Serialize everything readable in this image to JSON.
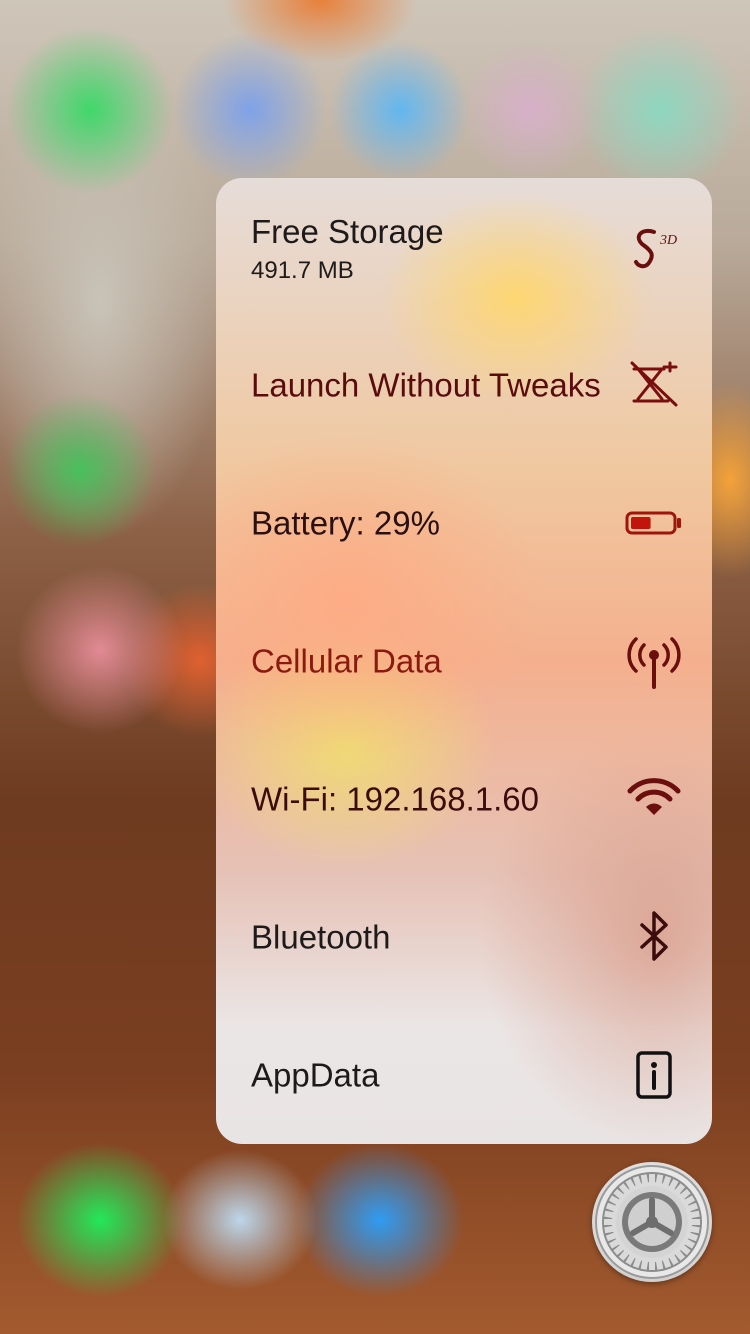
{
  "menu": {
    "items": [
      {
        "title": "Free Storage",
        "subtitle": "491.7 MB",
        "icon": "s3d-logo-icon"
      },
      {
        "title": "Launch Without Tweaks",
        "icon": "no-tweaks-icon"
      },
      {
        "title": "Battery: 29%",
        "icon": "battery-icon",
        "battery_level": 0.29
      },
      {
        "title": "Cellular Data",
        "icon": "cellular-antenna-icon"
      },
      {
        "title": "Wi-Fi: 192.168.1.60",
        "icon": "wifi-icon"
      },
      {
        "title": "Bluetooth",
        "icon": "bluetooth-icon"
      },
      {
        "title": "AppData",
        "icon": "info-icon"
      }
    ]
  },
  "colors": {
    "accent_dark_red": "#5a0c0c",
    "accent_red": "#8a1a10",
    "battery_fill": "#c0140c"
  },
  "dock": {
    "settings_icon": "settings-gear-icon"
  }
}
